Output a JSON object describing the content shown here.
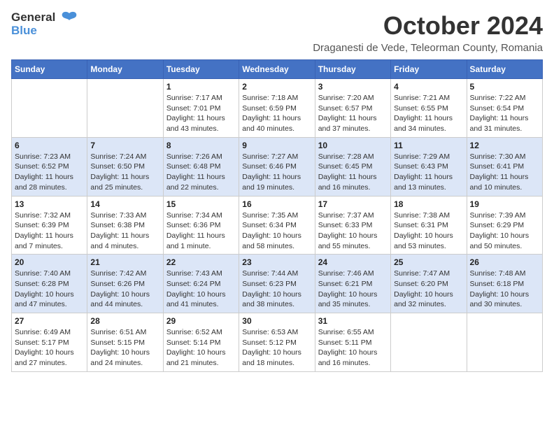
{
  "header": {
    "logo_general": "General",
    "logo_blue": "Blue",
    "month_title": "October 2024",
    "subtitle": "Draganesti de Vede, Teleorman County, Romania"
  },
  "days_of_week": [
    "Sunday",
    "Monday",
    "Tuesday",
    "Wednesday",
    "Thursday",
    "Friday",
    "Saturday"
  ],
  "weeks": [
    {
      "cells": [
        {
          "day": "",
          "info": ""
        },
        {
          "day": "",
          "info": ""
        },
        {
          "day": "1",
          "info": "Sunrise: 7:17 AM\nSunset: 7:01 PM\nDaylight: 11 hours and 43 minutes."
        },
        {
          "day": "2",
          "info": "Sunrise: 7:18 AM\nSunset: 6:59 PM\nDaylight: 11 hours and 40 minutes."
        },
        {
          "day": "3",
          "info": "Sunrise: 7:20 AM\nSunset: 6:57 PM\nDaylight: 11 hours and 37 minutes."
        },
        {
          "day": "4",
          "info": "Sunrise: 7:21 AM\nSunset: 6:55 PM\nDaylight: 11 hours and 34 minutes."
        },
        {
          "day": "5",
          "info": "Sunrise: 7:22 AM\nSunset: 6:54 PM\nDaylight: 11 hours and 31 minutes."
        }
      ]
    },
    {
      "cells": [
        {
          "day": "6",
          "info": "Sunrise: 7:23 AM\nSunset: 6:52 PM\nDaylight: 11 hours and 28 minutes."
        },
        {
          "day": "7",
          "info": "Sunrise: 7:24 AM\nSunset: 6:50 PM\nDaylight: 11 hours and 25 minutes."
        },
        {
          "day": "8",
          "info": "Sunrise: 7:26 AM\nSunset: 6:48 PM\nDaylight: 11 hours and 22 minutes."
        },
        {
          "day": "9",
          "info": "Sunrise: 7:27 AM\nSunset: 6:46 PM\nDaylight: 11 hours and 19 minutes."
        },
        {
          "day": "10",
          "info": "Sunrise: 7:28 AM\nSunset: 6:45 PM\nDaylight: 11 hours and 16 minutes."
        },
        {
          "day": "11",
          "info": "Sunrise: 7:29 AM\nSunset: 6:43 PM\nDaylight: 11 hours and 13 minutes."
        },
        {
          "day": "12",
          "info": "Sunrise: 7:30 AM\nSunset: 6:41 PM\nDaylight: 11 hours and 10 minutes."
        }
      ]
    },
    {
      "cells": [
        {
          "day": "13",
          "info": "Sunrise: 7:32 AM\nSunset: 6:39 PM\nDaylight: 11 hours and 7 minutes."
        },
        {
          "day": "14",
          "info": "Sunrise: 7:33 AM\nSunset: 6:38 PM\nDaylight: 11 hours and 4 minutes."
        },
        {
          "day": "15",
          "info": "Sunrise: 7:34 AM\nSunset: 6:36 PM\nDaylight: 11 hours and 1 minute."
        },
        {
          "day": "16",
          "info": "Sunrise: 7:35 AM\nSunset: 6:34 PM\nDaylight: 10 hours and 58 minutes."
        },
        {
          "day": "17",
          "info": "Sunrise: 7:37 AM\nSunset: 6:33 PM\nDaylight: 10 hours and 55 minutes."
        },
        {
          "day": "18",
          "info": "Sunrise: 7:38 AM\nSunset: 6:31 PM\nDaylight: 10 hours and 53 minutes."
        },
        {
          "day": "19",
          "info": "Sunrise: 7:39 AM\nSunset: 6:29 PM\nDaylight: 10 hours and 50 minutes."
        }
      ]
    },
    {
      "cells": [
        {
          "day": "20",
          "info": "Sunrise: 7:40 AM\nSunset: 6:28 PM\nDaylight: 10 hours and 47 minutes."
        },
        {
          "day": "21",
          "info": "Sunrise: 7:42 AM\nSunset: 6:26 PM\nDaylight: 10 hours and 44 minutes."
        },
        {
          "day": "22",
          "info": "Sunrise: 7:43 AM\nSunset: 6:24 PM\nDaylight: 10 hours and 41 minutes."
        },
        {
          "day": "23",
          "info": "Sunrise: 7:44 AM\nSunset: 6:23 PM\nDaylight: 10 hours and 38 minutes."
        },
        {
          "day": "24",
          "info": "Sunrise: 7:46 AM\nSunset: 6:21 PM\nDaylight: 10 hours and 35 minutes."
        },
        {
          "day": "25",
          "info": "Sunrise: 7:47 AM\nSunset: 6:20 PM\nDaylight: 10 hours and 32 minutes."
        },
        {
          "day": "26",
          "info": "Sunrise: 7:48 AM\nSunset: 6:18 PM\nDaylight: 10 hours and 30 minutes."
        }
      ]
    },
    {
      "cells": [
        {
          "day": "27",
          "info": "Sunrise: 6:49 AM\nSunset: 5:17 PM\nDaylight: 10 hours and 27 minutes."
        },
        {
          "day": "28",
          "info": "Sunrise: 6:51 AM\nSunset: 5:15 PM\nDaylight: 10 hours and 24 minutes."
        },
        {
          "day": "29",
          "info": "Sunrise: 6:52 AM\nSunset: 5:14 PM\nDaylight: 10 hours and 21 minutes."
        },
        {
          "day": "30",
          "info": "Sunrise: 6:53 AM\nSunset: 5:12 PM\nDaylight: 10 hours and 18 minutes."
        },
        {
          "day": "31",
          "info": "Sunrise: 6:55 AM\nSunset: 5:11 PM\nDaylight: 10 hours and 16 minutes."
        },
        {
          "day": "",
          "info": ""
        },
        {
          "day": "",
          "info": ""
        }
      ]
    }
  ]
}
